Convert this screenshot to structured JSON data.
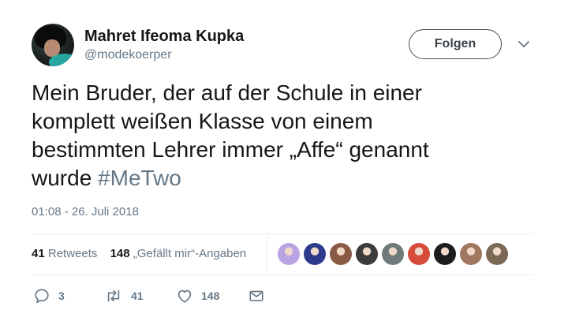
{
  "author": {
    "name": "Mahret Ifeoma Kupka",
    "handle": "@modekoerper"
  },
  "follow_label": "Folgen",
  "tweet": {
    "text_lines": [
      "Mein Bruder, der auf der Schule in einer",
      "komplett weißen Klasse von einem",
      "bestimmten Lehrer immer „Affe“ genannt",
      "wurde "
    ],
    "hashtag": "#MeTwo",
    "timestamp": "01:08 - 26. Juli 2018"
  },
  "stats": {
    "retweets_count": "41",
    "retweets_label": "Retweets",
    "likes_count": "148",
    "likes_label": "„Gefällt mir“-Angaben"
  },
  "likers": [
    {
      "name": "liker-avatar",
      "color": "#b9a3e3"
    },
    {
      "name": "liker-avatar",
      "color": "#2e3a8c"
    },
    {
      "name": "liker-avatar",
      "color": "#8a5a44"
    },
    {
      "name": "liker-avatar",
      "color": "#3b3b3b"
    },
    {
      "name": "liker-avatar",
      "color": "#6f7b7a"
    },
    {
      "name": "liker-avatar",
      "color": "#d64b3a"
    },
    {
      "name": "liker-avatar",
      "color": "#1d1d1d"
    },
    {
      "name": "liker-avatar",
      "color": "#a0785f"
    },
    {
      "name": "liker-avatar",
      "color": "#7a6a55"
    }
  ],
  "actions": {
    "reply_count": "3",
    "retweet_count": "41",
    "like_count": "148"
  },
  "icons": {
    "reply": "reply-icon",
    "retweet": "retweet-icon",
    "like": "heart-icon",
    "dm": "envelope-icon",
    "more": "chevron-down-icon"
  },
  "colors": {
    "text": "#14171a",
    "muted": "#657786",
    "divider": "#e6ecf0"
  }
}
